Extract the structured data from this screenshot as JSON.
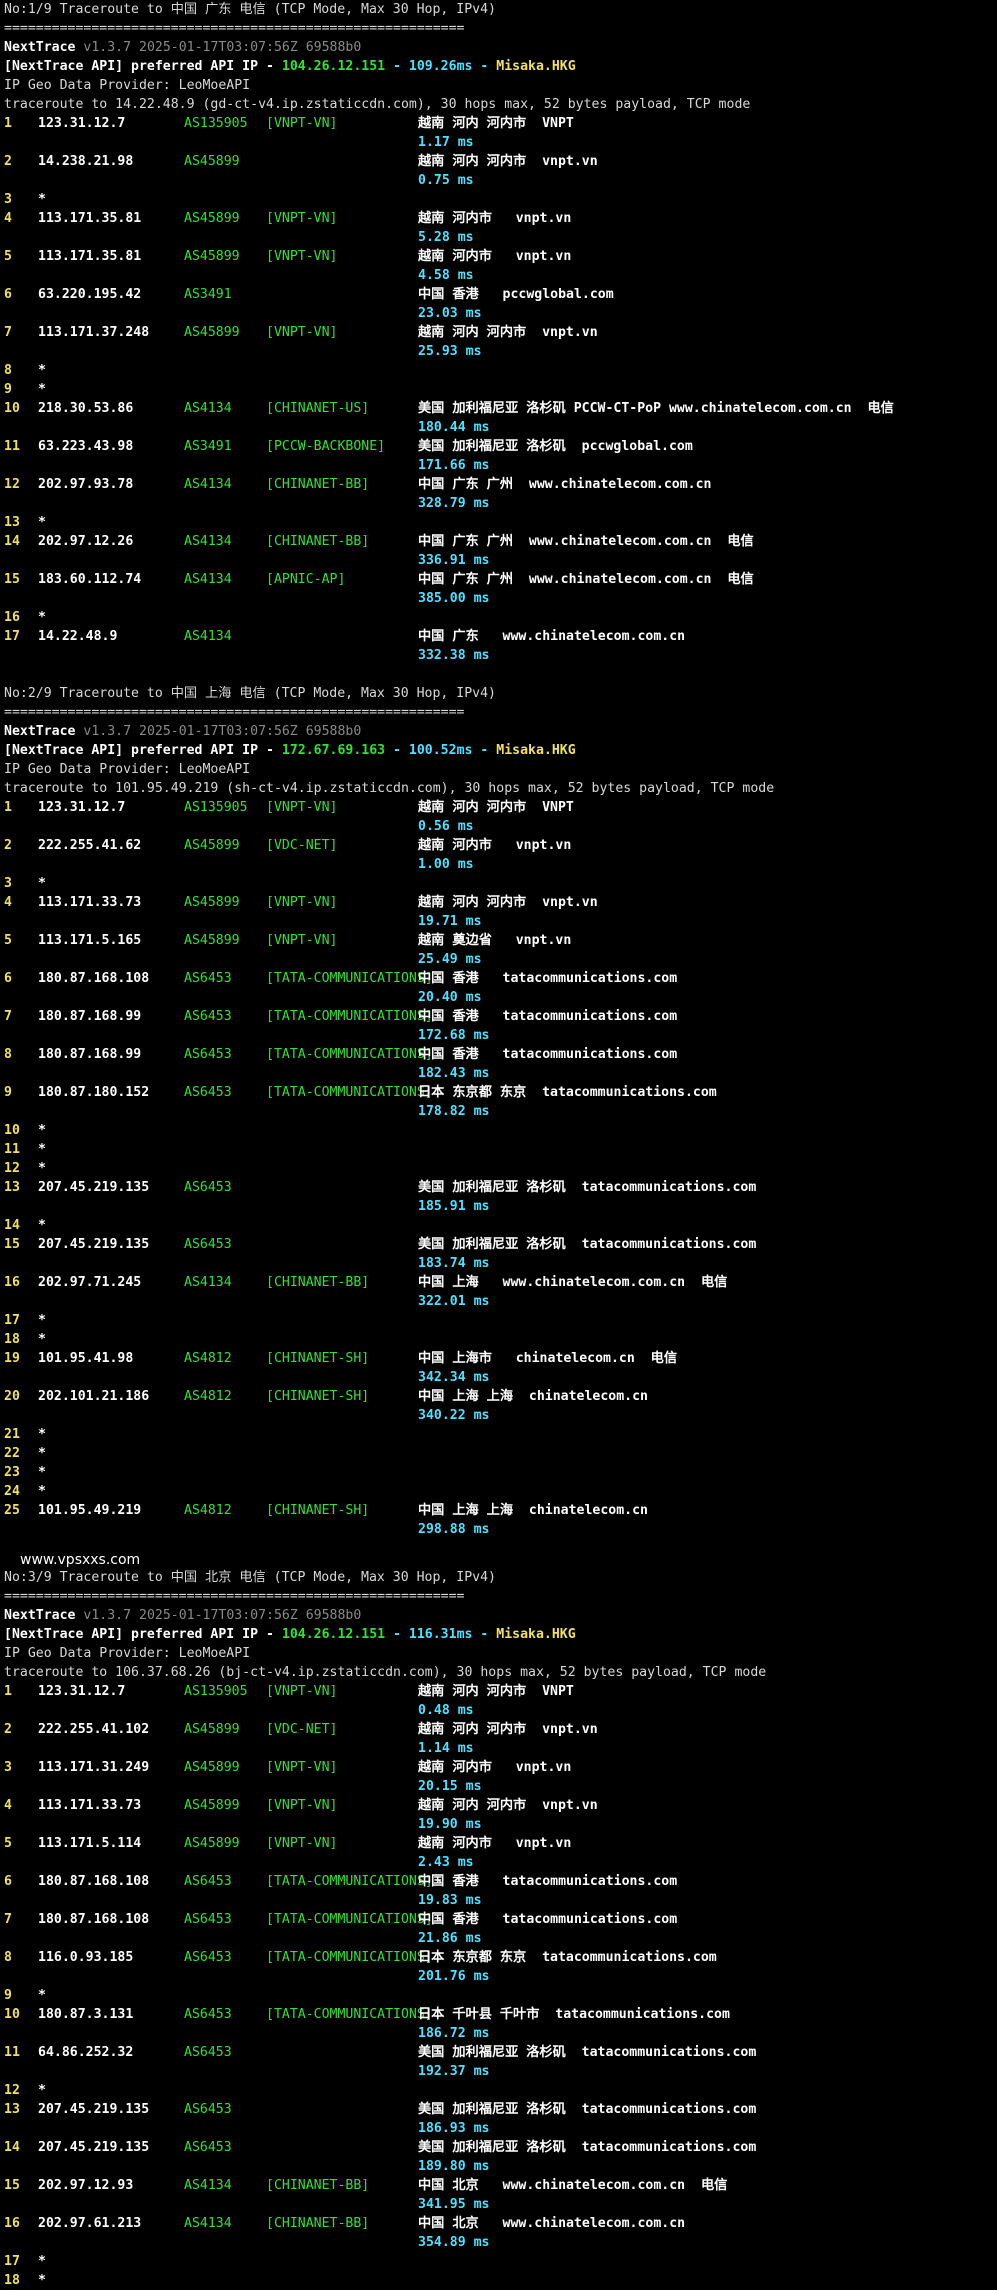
{
  "watermark": "www.vpsxxs.com",
  "sections": [
    {
      "title": "No:1/9 Traceroute to 中国 广东 电信 (TCP Mode, Max 30 Hop, IPv4)",
      "separator": "==========================================================",
      "app": "NextTrace",
      "version": "v1.3.7 2025-01-17T03:07:56Z 69588b0",
      "api_prefix": "[NextTrace API] preferred API IP - ",
      "api_ip": "104.26.12.151",
      "api_ms": " - 109.26ms - ",
      "api_node": "Misaka.HKG",
      "provider": "IP Geo Data Provider: LeoMoeAPI",
      "traceroute": "traceroute to 14.22.48.9 (gd-ct-v4.ip.zstaticcdn.com), 30 hops max, 52 bytes payload, TCP mode",
      "rows": [
        {
          "n": "1",
          "ip": "123.31.12.7",
          "asn": "AS135905",
          "tag": "[VNPT-VN]",
          "geo": "越南 河内 河内市  VNPT",
          "rtt": "1.17 ms"
        },
        {
          "n": "2",
          "ip": "14.238.21.98",
          "asn": "AS45899",
          "tag": "",
          "geo": "越南 河内 河内市  vnpt.vn",
          "rtt": "0.75 ms"
        },
        {
          "n": "3",
          "star": true
        },
        {
          "n": "4",
          "ip": "113.171.35.81",
          "asn": "AS45899",
          "tag": "[VNPT-VN]",
          "geo": "越南 河内市   vnpt.vn",
          "rtt": "5.28 ms"
        },
        {
          "n": "5",
          "ip": "113.171.35.81",
          "asn": "AS45899",
          "tag": "[VNPT-VN]",
          "geo": "越南 河内市   vnpt.vn",
          "rtt": "4.58 ms"
        },
        {
          "n": "6",
          "ip": "63.220.195.42",
          "asn": "AS3491",
          "tag": "",
          "geo": "中国 香港   pccwglobal.com",
          "rtt": "23.03 ms"
        },
        {
          "n": "7",
          "ip": "113.171.37.248",
          "asn": "AS45899",
          "tag": "[VNPT-VN]",
          "geo": "越南 河内 河内市  vnpt.vn",
          "rtt": "25.93 ms"
        },
        {
          "n": "8",
          "star": true
        },
        {
          "n": "9",
          "star": true
        },
        {
          "n": "10",
          "ip": "218.30.53.86",
          "asn": "AS4134",
          "tag": "[CHINANET-US]",
          "geo": "美国 加利福尼亚 洛杉矶 PCCW-CT-PoP www.chinatelecom.com.cn  电信",
          "rtt": "180.44 ms"
        },
        {
          "n": "11",
          "ip": "63.223.43.98",
          "asn": "AS3491",
          "tag": "[PCCW-BACKBONE]",
          "geo": "美国 加利福尼亚 洛杉矶  pccwglobal.com",
          "rtt": "171.66 ms"
        },
        {
          "n": "12",
          "ip": "202.97.93.78",
          "asn": "AS4134",
          "tag": "[CHINANET-BB]",
          "geo": "中国 广东 广州  www.chinatelecom.com.cn",
          "rtt": "328.79 ms"
        },
        {
          "n": "13",
          "star": true
        },
        {
          "n": "14",
          "ip": "202.97.12.26",
          "asn": "AS4134",
          "tag": "[CHINANET-BB]",
          "geo": "中国 广东 广州  www.chinatelecom.com.cn  电信",
          "rtt": "336.91 ms"
        },
        {
          "n": "15",
          "ip": "183.60.112.74",
          "asn": "AS4134",
          "tag": "[APNIC-AP]",
          "geo": "中国 广东 广州  www.chinatelecom.com.cn  电信",
          "rtt": "385.00 ms"
        },
        {
          "n": "16",
          "star": true
        },
        {
          "n": "17",
          "ip": "14.22.48.9",
          "asn": "AS4134",
          "tag": "",
          "geo": "中国 广东   www.chinatelecom.com.cn",
          "rtt": "332.38 ms"
        }
      ]
    },
    {
      "title": "No:2/9 Traceroute to 中国 上海 电信 (TCP Mode, Max 30 Hop, IPv4)",
      "separator": "==========================================================",
      "app": "NextTrace",
      "version": "v1.3.7 2025-01-17T03:07:56Z 69588b0",
      "api_prefix": "[NextTrace API] preferred API IP - ",
      "api_ip": "172.67.69.163",
      "api_ms": " - 100.52ms - ",
      "api_node": "Misaka.HKG",
      "provider": "IP Geo Data Provider: LeoMoeAPI",
      "traceroute": "traceroute to 101.95.49.219 (sh-ct-v4.ip.zstaticcdn.com), 30 hops max, 52 bytes payload, TCP mode",
      "rows": [
        {
          "n": "1",
          "ip": "123.31.12.7",
          "asn": "AS135905",
          "tag": "[VNPT-VN]",
          "geo": "越南 河内 河内市  VNPT",
          "rtt": "0.56 ms"
        },
        {
          "n": "2",
          "ip": "222.255.41.62",
          "asn": "AS45899",
          "tag": "[VDC-NET]",
          "geo": "越南 河内市   vnpt.vn",
          "rtt": "1.00 ms"
        },
        {
          "n": "3",
          "star": true
        },
        {
          "n": "4",
          "ip": "113.171.33.73",
          "asn": "AS45899",
          "tag": "[VNPT-VN]",
          "geo": "越南 河内 河内市  vnpt.vn",
          "rtt": "19.71 ms"
        },
        {
          "n": "5",
          "ip": "113.171.5.165",
          "asn": "AS45899",
          "tag": "[VNPT-VN]",
          "geo": "越南 奠边省   vnpt.vn",
          "rtt": "25.49 ms"
        },
        {
          "n": "6",
          "ip": "180.87.168.108",
          "asn": "AS6453",
          "tag": "[TATA-COMMUNICATIONS]",
          "geo": "中国 香港   tatacommunications.com",
          "rtt": "20.40 ms"
        },
        {
          "n": "7",
          "ip": "180.87.168.99",
          "asn": "AS6453",
          "tag": "[TATA-COMMUNICATIONS]",
          "geo": "中国 香港   tatacommunications.com",
          "rtt": "172.68 ms"
        },
        {
          "n": "8",
          "ip": "180.87.168.99",
          "asn": "AS6453",
          "tag": "[TATA-COMMUNICATIONS]",
          "geo": "中国 香港   tatacommunications.com",
          "rtt": "182.43 ms"
        },
        {
          "n": "9",
          "ip": "180.87.180.152",
          "asn": "AS6453",
          "tag": "[TATA-COMMUNICATIONS]",
          "geo": "日本 东京都 东京  tatacommunications.com",
          "rtt": "178.82 ms"
        },
        {
          "n": "10",
          "star": true
        },
        {
          "n": "11",
          "star": true
        },
        {
          "n": "12",
          "star": true
        },
        {
          "n": "13",
          "ip": "207.45.219.135",
          "asn": "AS6453",
          "tag": "",
          "geo": "美国 加利福尼亚 洛杉矶  tatacommunications.com",
          "rtt": "185.91 ms"
        },
        {
          "n": "14",
          "star": true
        },
        {
          "n": "15",
          "ip": "207.45.219.135",
          "asn": "AS6453",
          "tag": "",
          "geo": "美国 加利福尼亚 洛杉矶  tatacommunications.com",
          "rtt": "183.74 ms"
        },
        {
          "n": "16",
          "ip": "202.97.71.245",
          "asn": "AS4134",
          "tag": "[CHINANET-BB]",
          "geo": "中国 上海   www.chinatelecom.com.cn  电信",
          "rtt": "322.01 ms"
        },
        {
          "n": "17",
          "star": true
        },
        {
          "n": "18",
          "star": true
        },
        {
          "n": "19",
          "ip": "101.95.41.98",
          "asn": "AS4812",
          "tag": "[CHINANET-SH]",
          "geo": "中国 上海市   chinatelecom.cn  电信",
          "rtt": "342.34 ms"
        },
        {
          "n": "20",
          "ip": "202.101.21.186",
          "asn": "AS4812",
          "tag": "[CHINANET-SH]",
          "geo": "中国 上海 上海  chinatelecom.cn",
          "rtt": "340.22 ms"
        },
        {
          "n": "21",
          "star": true
        },
        {
          "n": "22",
          "star": true
        },
        {
          "n": "23",
          "star": true
        },
        {
          "n": "24",
          "star": true
        },
        {
          "n": "25",
          "ip": "101.95.49.219",
          "asn": "AS4812",
          "tag": "[CHINANET-SH]",
          "geo": "中国 上海 上海  chinatelecom.cn",
          "rtt": "298.88 ms"
        }
      ]
    },
    {
      "title": "No:3/9 Traceroute to 中国 北京 电信 (TCP Mode, Max 30 Hop, IPv4)",
      "separator": "==========================================================",
      "app": "NextTrace",
      "version": "v1.3.7 2025-01-17T03:07:56Z 69588b0",
      "api_prefix": "[NextTrace API] preferred API IP - ",
      "api_ip": "104.26.12.151",
      "api_ms": " - 116.31ms - ",
      "api_node": "Misaka.HKG",
      "provider": "IP Geo Data Provider: LeoMoeAPI",
      "traceroute": "traceroute to 106.37.68.26 (bj-ct-v4.ip.zstaticcdn.com), 30 hops max, 52 bytes payload, TCP mode",
      "rows": [
        {
          "n": "1",
          "ip": "123.31.12.7",
          "asn": "AS135905",
          "tag": "[VNPT-VN]",
          "geo": "越南 河内 河内市  VNPT",
          "rtt": "0.48 ms"
        },
        {
          "n": "2",
          "ip": "222.255.41.102",
          "asn": "AS45899",
          "tag": "[VDC-NET]",
          "geo": "越南 河内 河内市  vnpt.vn",
          "rtt": "1.14 ms"
        },
        {
          "n": "3",
          "ip": "113.171.31.249",
          "asn": "AS45899",
          "tag": "[VNPT-VN]",
          "geo": "越南 河内市   vnpt.vn",
          "rtt": "20.15 ms"
        },
        {
          "n": "4",
          "ip": "113.171.33.73",
          "asn": "AS45899",
          "tag": "[VNPT-VN]",
          "geo": "越南 河内 河内市  vnpt.vn",
          "rtt": "19.90 ms"
        },
        {
          "n": "5",
          "ip": "113.171.5.114",
          "asn": "AS45899",
          "tag": "[VNPT-VN]",
          "geo": "越南 河内市   vnpt.vn",
          "rtt": "2.43 ms"
        },
        {
          "n": "6",
          "ip": "180.87.168.108",
          "asn": "AS6453",
          "tag": "[TATA-COMMUNICATIONS]",
          "geo": "中国 香港   tatacommunications.com",
          "rtt": "19.83 ms"
        },
        {
          "n": "7",
          "ip": "180.87.168.108",
          "asn": "AS6453",
          "tag": "[TATA-COMMUNICATIONS]",
          "geo": "中国 香港   tatacommunications.com",
          "rtt": "21.86 ms"
        },
        {
          "n": "8",
          "ip": "116.0.93.185",
          "asn": "AS6453",
          "tag": "[TATA-COMMUNICATIONS]",
          "geo": "日本 东京都 东京  tatacommunications.com",
          "rtt": "201.76 ms"
        },
        {
          "n": "9",
          "star": true
        },
        {
          "n": "10",
          "ip": "180.87.3.131",
          "asn": "AS6453",
          "tag": "[TATA-COMMUNICATIONS]",
          "geo": "日本 千叶县 千叶市  tatacommunications.com",
          "rtt": "186.72 ms"
        },
        {
          "n": "11",
          "ip": "64.86.252.32",
          "asn": "AS6453",
          "tag": "",
          "geo": "美国 加利福尼亚 洛杉矶  tatacommunications.com",
          "rtt": "192.37 ms"
        },
        {
          "n": "12",
          "star": true
        },
        {
          "n": "13",
          "ip": "207.45.219.135",
          "asn": "AS6453",
          "tag": "",
          "geo": "美国 加利福尼亚 洛杉矶  tatacommunications.com",
          "rtt": "186.93 ms"
        },
        {
          "n": "14",
          "ip": "207.45.219.135",
          "asn": "AS6453",
          "tag": "",
          "geo": "美国 加利福尼亚 洛杉矶  tatacommunications.com",
          "rtt": "189.80 ms"
        },
        {
          "n": "15",
          "ip": "202.97.12.93",
          "asn": "AS4134",
          "tag": "[CHINANET-BB]",
          "geo": "中国 北京   www.chinatelecom.com.cn  电信",
          "rtt": "341.95 ms"
        },
        {
          "n": "16",
          "ip": "202.97.61.213",
          "asn": "AS4134",
          "tag": "[CHINANET-BB]",
          "geo": "中国 北京   www.chinatelecom.com.cn",
          "rtt": "354.89 ms"
        },
        {
          "n": "17",
          "star": true
        },
        {
          "n": "18",
          "star": true
        }
      ]
    }
  ]
}
